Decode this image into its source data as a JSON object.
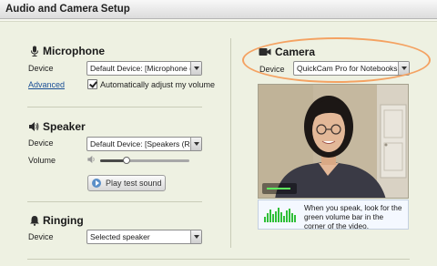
{
  "window": {
    "title": "Audio and Camera Setup"
  },
  "microphone": {
    "section_title": "Microphone",
    "device_label": "Device",
    "device_value": "Default Device: [Microphone (Re",
    "advanced_link": "Advanced",
    "auto_adjust_label": "Automatically adjust my volume",
    "auto_adjust_checked": true
  },
  "speaker": {
    "section_title": "Speaker",
    "device_label": "Device",
    "device_value": "Default Device: [Speakers (Real",
    "volume_label": "Volume",
    "volume_level": 0.3,
    "test_button": "Play test sound"
  },
  "ringing": {
    "section_title": "Ringing",
    "device_label": "Device",
    "device_value": "Selected speaker"
  },
  "camera": {
    "section_title": "Camera",
    "device_label": "Device",
    "device_value": "QuickCam Pro for Notebooks",
    "tip_text": "When you speak, look for the green volume bar in the corner of the video."
  },
  "colors": {
    "panel_bg": "#eef1e2",
    "highlight": "#f4a262",
    "link": "#1a4f96",
    "volume_green": "#2fbf37"
  },
  "icons": [
    "microphone-icon",
    "speaker-icon",
    "bell-icon",
    "camera-icon",
    "play-icon",
    "volume-icon"
  ]
}
